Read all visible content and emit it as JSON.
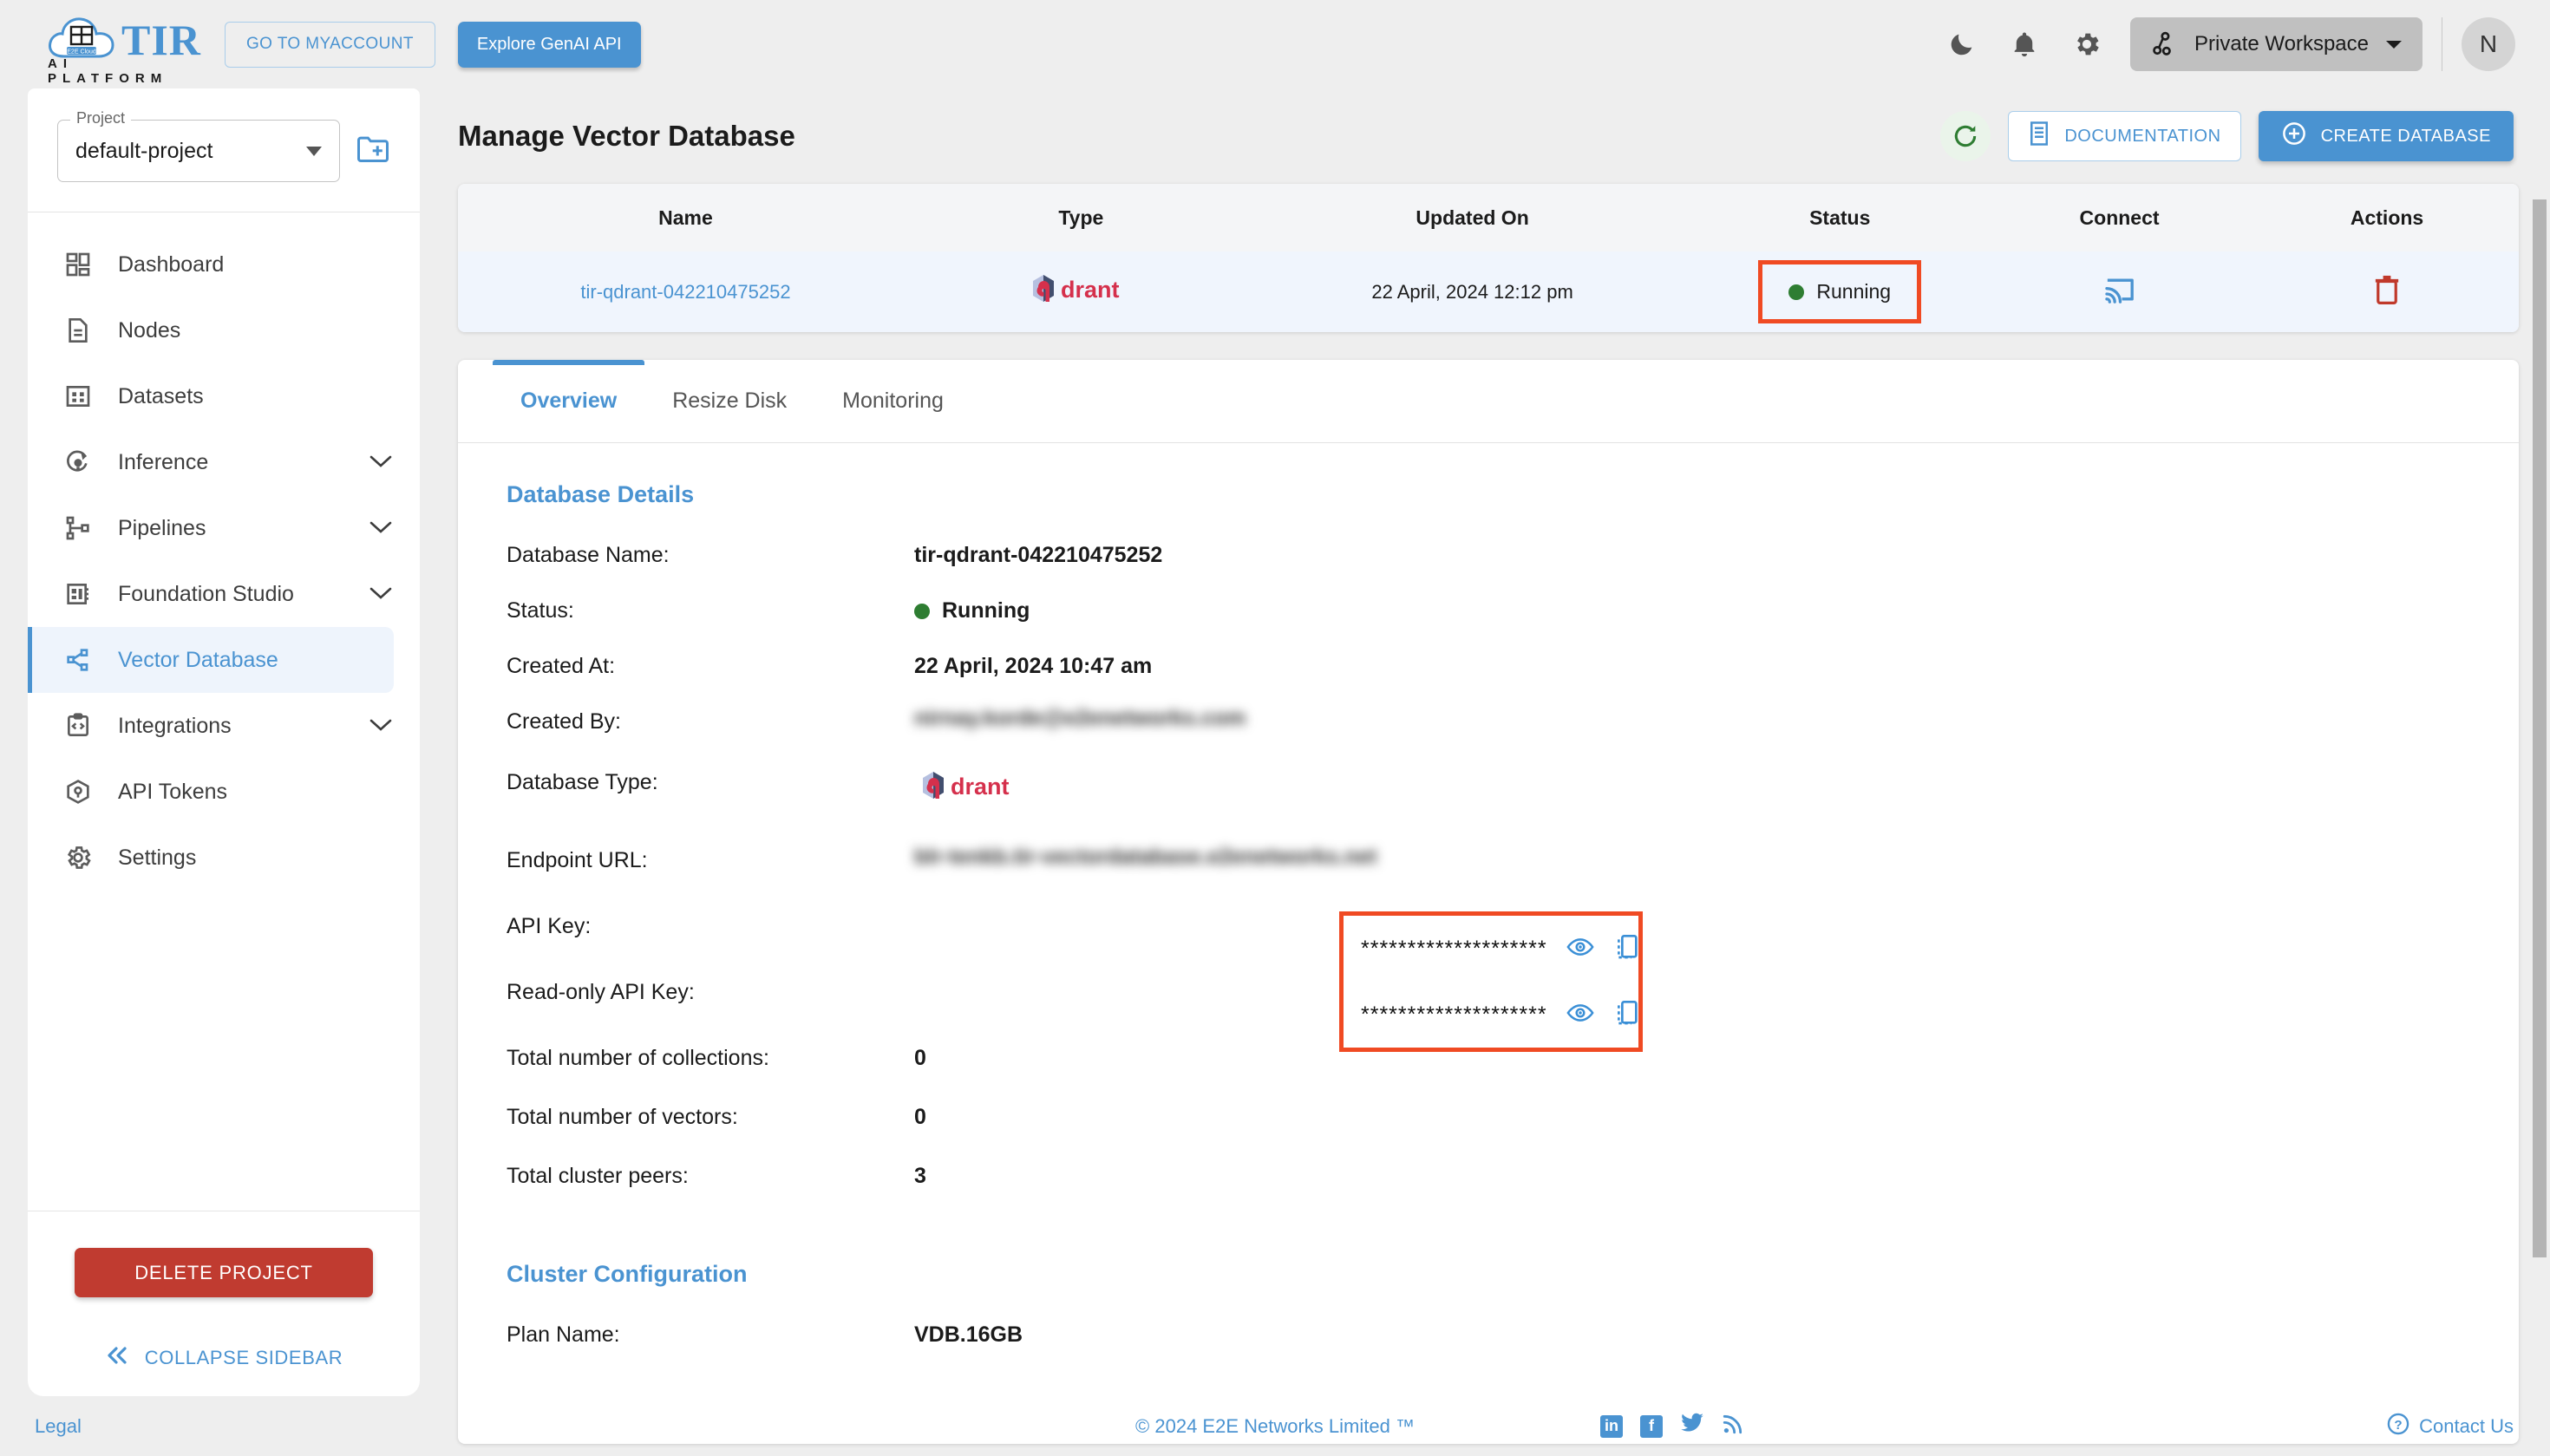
{
  "topbar": {
    "brand_name": "TIR",
    "brand_sub": "AI PLATFORM",
    "brand_cloud_text": "E2E Cloud",
    "myaccount_label": "GO TO MYACCOUNT",
    "genai_label": "Explore GenAI API",
    "icons": [
      "moon-icon",
      "bell-icon",
      "gear-icon"
    ],
    "workspace_label": "Private Workspace",
    "avatar_initial": "N"
  },
  "sidebar": {
    "project_label": "Project",
    "project_value": "default-project",
    "new_project_icon": "new-folder-icon",
    "items": [
      {
        "label": "Dashboard",
        "icon": "dashboard-icon",
        "chevron": false,
        "active": false
      },
      {
        "label": "Nodes",
        "icon": "document-icon",
        "chevron": false,
        "active": false
      },
      {
        "label": "Datasets",
        "icon": "grid-icon",
        "chevron": false,
        "active": false
      },
      {
        "label": "Inference",
        "icon": "inference-icon",
        "chevron": true,
        "active": false
      },
      {
        "label": "Pipelines",
        "icon": "pipelines-icon",
        "chevron": true,
        "active": false
      },
      {
        "label": "Foundation Studio",
        "icon": "studio-icon",
        "chevron": true,
        "active": false
      },
      {
        "label": "Vector Database",
        "icon": "vector-db-icon",
        "chevron": false,
        "active": true
      },
      {
        "label": "Integrations",
        "icon": "code-icon",
        "chevron": true,
        "active": false
      },
      {
        "label": "API Tokens",
        "icon": "cube-icon",
        "chevron": false,
        "active": false
      },
      {
        "label": "Settings",
        "icon": "settings-icon",
        "chevron": false,
        "active": false
      }
    ],
    "delete_project_label": "DELETE PROJECT",
    "collapse_label": "COLLAPSE SIDEBAR",
    "collapse_icon": "chevron-double-left-icon"
  },
  "main": {
    "page_title": "Manage Vector Database",
    "refresh_icon": "refresh-icon",
    "documentation_label": "DOCUMENTATION",
    "documentation_icon": "book-icon",
    "create_label": "CREATE DATABASE",
    "create_icon": "plus-circle-icon",
    "table": {
      "columns": [
        "Name",
        "Type",
        "Updated On",
        "Status",
        "Connect",
        "Actions"
      ],
      "rows": [
        {
          "name": "tir-qdrant-042210475252",
          "type": "qdrant",
          "updated_on": "22 April, 2024 12:12 pm",
          "status": "Running",
          "status_color": "#2e7d32",
          "connect_icon": "cast-connect-icon",
          "action_icon": "trash-icon"
        }
      ]
    },
    "tabs": [
      {
        "label": "Overview",
        "active": true
      },
      {
        "label": "Resize Disk",
        "active": false
      },
      {
        "label": "Monitoring",
        "active": false
      }
    ],
    "details": {
      "section_title": "Database Details",
      "fields": [
        {
          "label": "Database Name:",
          "value": "tir-qdrant-042210475252",
          "kind": "text"
        },
        {
          "label": "Status:",
          "value": "Running",
          "kind": "status"
        },
        {
          "label": "Created At:",
          "value": "22 April, 2024 10:47 am",
          "kind": "text"
        },
        {
          "label": "Created By:",
          "value": "nirnay.korde@e2enetworks.com",
          "kind": "blurred"
        },
        {
          "label": "Database Type:",
          "value": "qdrant",
          "kind": "logo"
        },
        {
          "label": "Endpoint URL:",
          "value": "blr-tenkb.tir-vectordatabase.e2enetworks.net",
          "kind": "blurred"
        },
        {
          "label": "API Key:",
          "value": "********************",
          "kind": "secret"
        },
        {
          "label": "Read-only API Key:",
          "value": "********************",
          "kind": "secret"
        },
        {
          "label": "Total number of collections:",
          "value": "0",
          "kind": "text"
        },
        {
          "label": "Total number of vectors:",
          "value": "0",
          "kind": "text"
        },
        {
          "label": "Total cluster peers:",
          "value": "3",
          "kind": "text"
        }
      ],
      "secret_eye_icon": "eye-icon",
      "secret_copy_icon": "copy-icon"
    },
    "cluster": {
      "section_title": "Cluster Configuration",
      "fields": [
        {
          "label": "Plan Name:",
          "value": "VDB.16GB"
        }
      ]
    },
    "highlight_color": "#f04a23"
  },
  "footer": {
    "legal": "Legal",
    "copyright": "© 2024 E2E Networks Limited ™",
    "social": [
      "linkedin-icon",
      "facebook-icon",
      "twitter-icon",
      "rss-icon"
    ],
    "contact": "Contact Us",
    "contact_icon": "question-circle-icon"
  },
  "accent": "#4a93d1"
}
